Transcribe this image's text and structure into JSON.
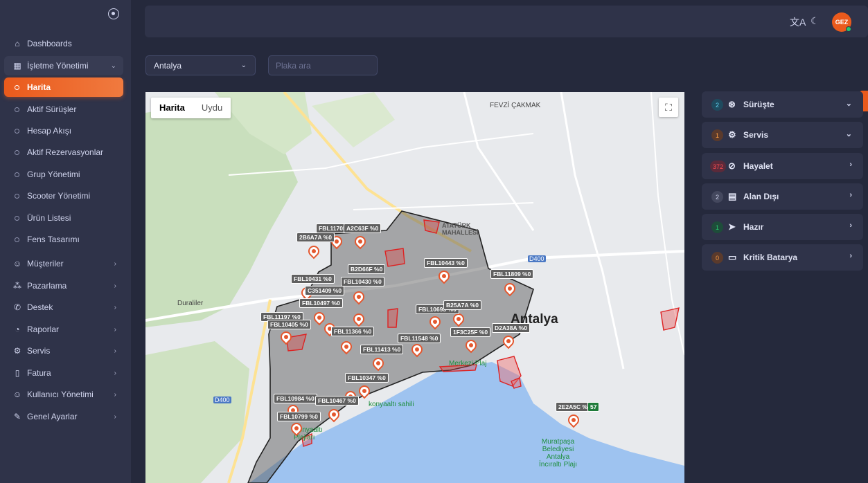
{
  "sidebar": {
    "items": [
      {
        "label": "Dashboards",
        "icon": "home-icon"
      },
      {
        "label": "İşletme Yönetimi",
        "icon": "building-icon",
        "open": true
      },
      {
        "label": "Müşteriler",
        "icon": "users-icon"
      },
      {
        "label": "Pazarlama",
        "icon": "share-icon"
      },
      {
        "label": "Destek",
        "icon": "phone-icon"
      },
      {
        "label": "Raporlar",
        "icon": "pie-chart-icon"
      },
      {
        "label": "Servis",
        "icon": "gear-icon"
      },
      {
        "label": "Fatura",
        "icon": "sidebar-layout-icon"
      },
      {
        "label": "Kullanıcı Yönetimi",
        "icon": "user-group-icon"
      },
      {
        "label": "Genel Ayarlar",
        "icon": "tools-icon"
      }
    ],
    "subitems": [
      {
        "label": "Harita",
        "active": true
      },
      {
        "label": "Aktif Sürüşler"
      },
      {
        "label": "Hesap Akışı"
      },
      {
        "label": "Aktif Rezervasyonlar"
      },
      {
        "label": "Grup Yönetimi"
      },
      {
        "label": "Scooter Yönetimi"
      },
      {
        "label": "Ürün Listesi"
      },
      {
        "label": "Fens Tasarımı"
      }
    ]
  },
  "topbar": {
    "translate_icon": "translate-icon",
    "theme_icon": "moon-icon",
    "avatar_text": "GEZ"
  },
  "filters": {
    "city": "Antalya",
    "plate_placeholder": "Plaka ara"
  },
  "map": {
    "type_options": [
      "Harita",
      "Uydu"
    ],
    "selected_type": "Harita",
    "places": {
      "city": "Antalya",
      "district1": "Duraliler",
      "district2": "FEVZİ ÇAKMAK",
      "district3": "ATATÜRK\nMAHALLESİ",
      "beach": "konyaaltı sahili",
      "municipality": "Muratpaşa\nBelediyesi\nAntalya\nİncıraltı Plajı",
      "road": "D400",
      "merkezi": "Merkezi Plaj",
      "plaji": "Konyaaltı\nPlajları"
    },
    "vehicle_labels": [
      "FBL11705",
      "A2C63F %0",
      "2B6A7A %0",
      "B2D66F %0",
      "FBL10443 %0",
      "FBL10431 %0",
      "FBL10430 %0",
      "FBL11809 %0",
      "C351409 %0",
      "FBL10497 %0",
      "FBL11197 %0",
      "FBL10405 %0",
      "FBL11366 %0",
      "FBL10693 %0",
      "D2A38A %0",
      "FBL11548 %0",
      "FBL11413 %0",
      "FBL10347 %0",
      "FBL10984 %0",
      "FBL10467 %0",
      "FBL10799 %0",
      "2E2A5C %0",
      "1F3C25F %0",
      "B25A7A %0"
    ],
    "green_tag": "57"
  },
  "status_panel": [
    {
      "count": "2",
      "label": "Sürüşte",
      "icon": "steering-wheel-icon",
      "arrow": "chevron-down",
      "count_color": "#1f6f8b",
      "count_text_color": "#7fd8f0"
    },
    {
      "count": "1",
      "label": "Servis",
      "icon": "gear-icon",
      "arrow": "chevron-down",
      "count_color": "#5c3a2e",
      "count_text_color": "#ff9f43"
    },
    {
      "count": "372",
      "label": "Hayalet",
      "icon": "wifi-off-icon",
      "arrow": "chevron-right",
      "count_color": "#5b2a3a",
      "count_text_color": "#ff4c51"
    },
    {
      "count": "2",
      "label": "Alan Dışı",
      "icon": "map-icon",
      "arrow": "chevron-right",
      "count_color": "#44485e",
      "count_text_color": "#cfd3ec"
    },
    {
      "count": "1",
      "label": "Hazır",
      "icon": "send-icon",
      "arrow": "chevron-right",
      "count_color": "#1e4d3a",
      "count_text_color": "#28c76f"
    },
    {
      "count": "0",
      "label": "Kritik Batarya",
      "icon": "battery-icon",
      "arrow": "chevron-right",
      "count_color": "#5c3a2e",
      "count_text_color": "#ff9f43"
    }
  ]
}
